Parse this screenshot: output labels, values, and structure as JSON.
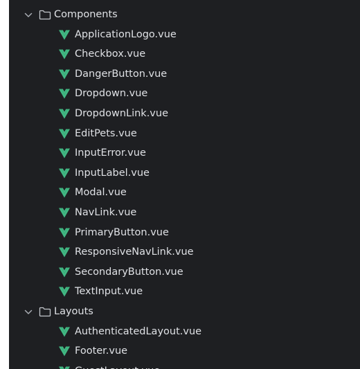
{
  "colors": {
    "panel_bg": "#1e1f22",
    "text": "#dfe1e5",
    "muted_icon": "#a9acb3",
    "vue_green": "#41b883"
  },
  "tree": {
    "components_folder": {
      "label": "Components",
      "chevron_icon": "chevron-down-icon",
      "folder_icon": "folder-icon",
      "files": [
        "ApplicationLogo.vue",
        "Checkbox.vue",
        "DangerButton.vue",
        "Dropdown.vue",
        "DropdownLink.vue",
        "EditPets.vue",
        "InputError.vue",
        "InputLabel.vue",
        "Modal.vue",
        "NavLink.vue",
        "PrimaryButton.vue",
        "ResponsiveNavLink.vue",
        "SecondaryButton.vue",
        "TextInput.vue"
      ]
    },
    "layouts_folder": {
      "label": "Layouts",
      "chevron_icon": "chevron-down-icon",
      "folder_icon": "folder-icon",
      "files": [
        "AuthenticatedLayout.vue",
        "Footer.vue",
        "GuestLayout.vue"
      ]
    },
    "file_icon": "vue-file-icon"
  }
}
